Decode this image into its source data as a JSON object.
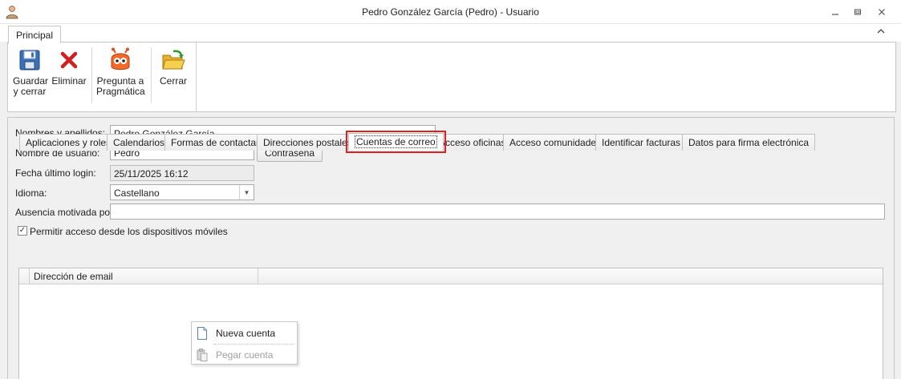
{
  "window": {
    "title": "Pedro González García (Pedro) - Usuario",
    "icon": "user-icon",
    "controls": [
      "minimize-icon",
      "restore-icon",
      "close-icon"
    ]
  },
  "ribbon": {
    "tab_label": "Principal",
    "buttons": [
      {
        "label_1": "Guardar",
        "label_2": "y cerrar",
        "icon": "save-icon"
      },
      {
        "label_1": "Eliminar",
        "label_2": "",
        "icon": "delete-icon"
      },
      {
        "label_1": "Pregunta a",
        "label_2": "Pragmática",
        "icon": "assistant-robot-icon"
      },
      {
        "label_1": "Cerrar",
        "label_2": "",
        "icon": "close-folder-icon"
      }
    ]
  },
  "form": {
    "name_label": "Nombres y apellidos:",
    "name_value": "Pedro González García",
    "username_label": "Nombre de usuario:",
    "username_value": "Pedro",
    "password_button": "Contraseña",
    "last_login_label": "Fecha último login:",
    "last_login_value": "25/11/2025 16:12",
    "language_label": "Idioma:",
    "language_value": "Castellano",
    "absence_label": "Ausencia motivada por:",
    "absence_value": "",
    "mobile_access_label": "Permitir acceso desde los dispositivos móviles",
    "mobile_access_checked": true
  },
  "tabs": [
    "Aplicaciones y roles",
    "Calendarios",
    "Formas de contactar",
    "Direcciones postales",
    "Cuentas de correo",
    "Acceso oficinas",
    "Acceso comunidades",
    "Identificar facturas",
    "Datos para firma electrónica"
  ],
  "active_tab": "Cuentas de correo",
  "grid": {
    "columns": [
      "Dirección de email"
    ],
    "rows": []
  },
  "context_menu": {
    "items": [
      {
        "label": "Nueva cuenta",
        "enabled": true,
        "icon": "new-document-icon"
      },
      {
        "label": "Pegar cuenta",
        "enabled": false,
        "icon": "paste-icon"
      }
    ]
  },
  "colors": {
    "highlight": "#e02020",
    "window_bg": "#f0f0f0"
  }
}
